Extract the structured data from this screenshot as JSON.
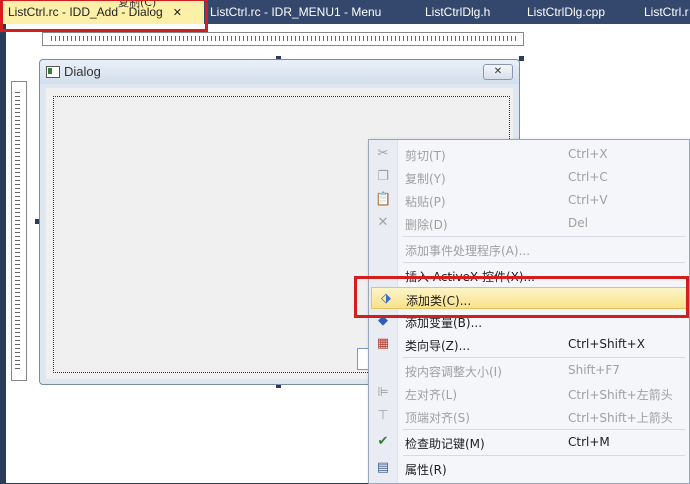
{
  "ghost_top_text": "复制(C)",
  "tabs": [
    {
      "label": "ListCtrl.rc - IDD_Add - Dialog",
      "close": "✕",
      "active": true
    },
    {
      "label": "ListCtrl.rc - IDR_MENU1 - Menu"
    },
    {
      "label": "ListCtrlDlg.h"
    },
    {
      "label": "ListCtrlDlg.cpp"
    },
    {
      "label": "ListCtrl.r"
    }
  ],
  "dialog": {
    "title": "Dialog",
    "close_glyph": "✕"
  },
  "context_menu": [
    {
      "label": "剪切(T)",
      "shortcut": "Ctrl+X",
      "disabled": true,
      "icon": "scissors-icon"
    },
    {
      "label": "复制(Y)",
      "shortcut": "Ctrl+C",
      "disabled": true,
      "icon": "copy-icon"
    },
    {
      "label": "粘贴(P)",
      "shortcut": "Ctrl+V",
      "disabled": true,
      "icon": "paste-icon"
    },
    {
      "label": "删除(D)",
      "shortcut": "Del",
      "disabled": true,
      "icon": "delete-icon"
    },
    {
      "label": "添加事件处理程序(A)...",
      "shortcut": "",
      "disabled": true,
      "icon": ""
    },
    {
      "label": "插入 ActiveX 控件(X)...",
      "shortcut": "",
      "disabled": false,
      "icon": ""
    },
    {
      "label": "添加类(C)...",
      "shortcut": "",
      "disabled": false,
      "icon": "add-class-icon",
      "selected": true
    },
    {
      "label": "添加变量(B)...",
      "shortcut": "",
      "disabled": false,
      "icon": "add-variable-icon"
    },
    {
      "label": "类向导(Z)...",
      "shortcut": "Ctrl+Shift+X",
      "disabled": false,
      "icon": "class-wizard-icon"
    },
    {
      "label": "按内容调整大小(I)",
      "shortcut": "Shift+F7",
      "disabled": true,
      "icon": ""
    },
    {
      "label": "左对齐(L)",
      "shortcut": "Ctrl+Shift+左箭头",
      "disabled": true,
      "icon": "align-left-icon"
    },
    {
      "label": "顶端对齐(S)",
      "shortcut": "Ctrl+Shift+上箭头",
      "disabled": true,
      "icon": "align-top-icon"
    },
    {
      "label": "检查助记键(M)",
      "shortcut": "Ctrl+M",
      "disabled": false,
      "icon": "check-mnemonics-icon"
    },
    {
      "label": "属性(R)",
      "shortcut": "",
      "disabled": false,
      "icon": "properties-icon"
    }
  ],
  "colors": {
    "highlight_border": "#d41e1e",
    "tab_active_bg": "#fcefa8",
    "tabbar_bg": "#34476d"
  }
}
